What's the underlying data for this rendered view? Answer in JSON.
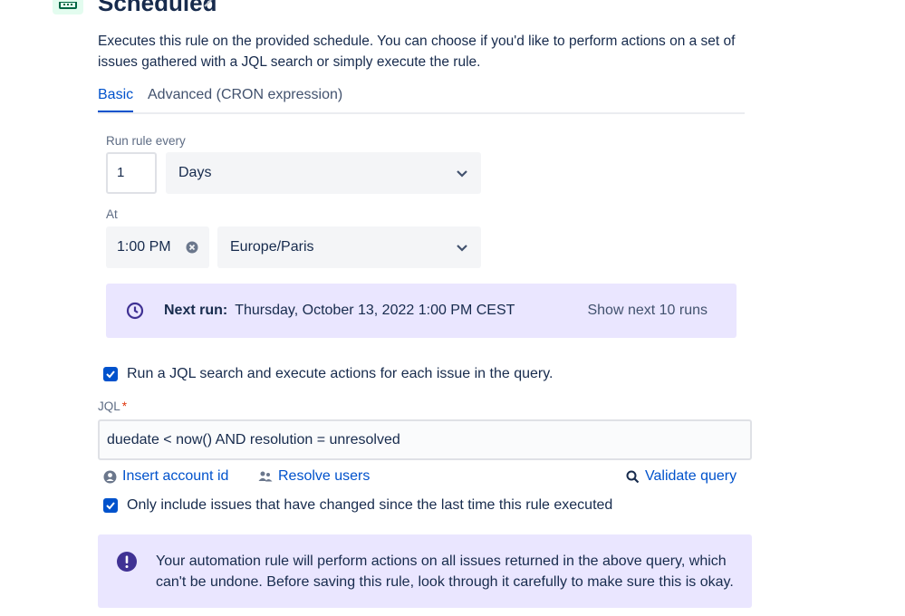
{
  "header": {
    "title": "Scheduled",
    "description": "Executes this rule on the provided schedule. You can choose if you'd like to perform actions on a set of issues gathered with a JQL search or simply execute the rule."
  },
  "tabs": [
    {
      "label": "Basic",
      "active": true
    },
    {
      "label": "Advanced (CRON expression)",
      "active": false
    }
  ],
  "schedule": {
    "run_every_label": "Run rule every",
    "interval_value": "1",
    "interval_unit": "Days",
    "at_label": "At",
    "time": "1:00 PM",
    "timezone": "Europe/Paris"
  },
  "next_run": {
    "label": "Next run:",
    "value": "Thursday, October 13, 2022 1:00 PM CEST",
    "show_button": "Show next 10 runs"
  },
  "jql": {
    "checkbox_label": "Run a JQL search and execute actions for each issue in the query.",
    "label": "JQL",
    "required_mark": "*",
    "value": "duedate < now() AND resolution = unresolved",
    "insert_account_id": "Insert account id",
    "resolve_users": "Resolve users",
    "validate_query": "Validate query",
    "changed_checkbox_label": "Only include issues that have changed since the last time this rule executed"
  },
  "warning": {
    "text": "Your automation rule will perform actions on all issues returned in the above query, which can't be undone. Before saving this rule, look through it carefully to make sure this is okay."
  },
  "colors": {
    "primary": "#0052cc",
    "purple_bg": "#eae6ff",
    "warning_icon": "#403294"
  }
}
